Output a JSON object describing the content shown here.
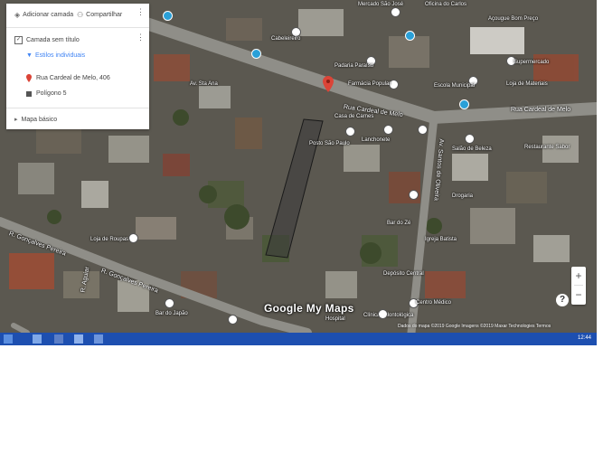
{
  "panel": {
    "add_layer": "Adicionar camada",
    "share": "Compartilhar",
    "layer_title": "Camada sem título",
    "layer_styles": "Estilos individuais",
    "place_label": "Rua Cardeal de Melo, 406",
    "polygon_label": "Polígono 5",
    "basemap": "Mapa básico"
  },
  "streets": {
    "main_street": "Rua Cardeal de Melo",
    "main_street_right": "Rua Cardeal de Melo",
    "street_lower_left": "R. Gonçalves Pereira",
    "street_lower_left_2": "R. Gonçalves Pereira",
    "street_vertical": "Av. Santos de Oliveira",
    "street_left_edge": "R. Aguiar"
  },
  "pois": {
    "p1": "Cabeleireiro",
    "p2": "Padaria Paraíso",
    "p3": "Av. Sta Ana",
    "p4": "Supermercado",
    "p5": "Farmácia Popular",
    "p6": "Escola Municipal",
    "p7": "Mercado São José",
    "p8": "Oficina do Carlos",
    "p9": "Posto São Paulo",
    "p10": "Lanchonete",
    "p11": "Salão de Beleza",
    "p12": "Drogaria",
    "p13": "Bar do Zé",
    "p14": "Igreja Batista",
    "p15": "Loja de Roupas",
    "p16": "Depósito Central",
    "p17": "Centro Médico",
    "p18": "Clínica Odontológica",
    "p19": "Bar do Japão",
    "p20": "Hospital",
    "p21": "Restaurante Sabor",
    "p22": "Açougue Bom Preço",
    "p23": "Loja de Materiais",
    "p24": "Casa de Carnes"
  },
  "map": {
    "logo": "Google My Maps",
    "attribution": "Dados do mapa ©2019 Google  Imagens ©2019 Maxar Technologies  Termos",
    "help": "?"
  },
  "taskbar": {
    "clock": "12:44"
  },
  "colors": {
    "panel_accent": "#4285f4",
    "place_marker": "#db4437",
    "polygon_fill": "#3a3a3a",
    "taskbar": "#1d4fb0"
  }
}
